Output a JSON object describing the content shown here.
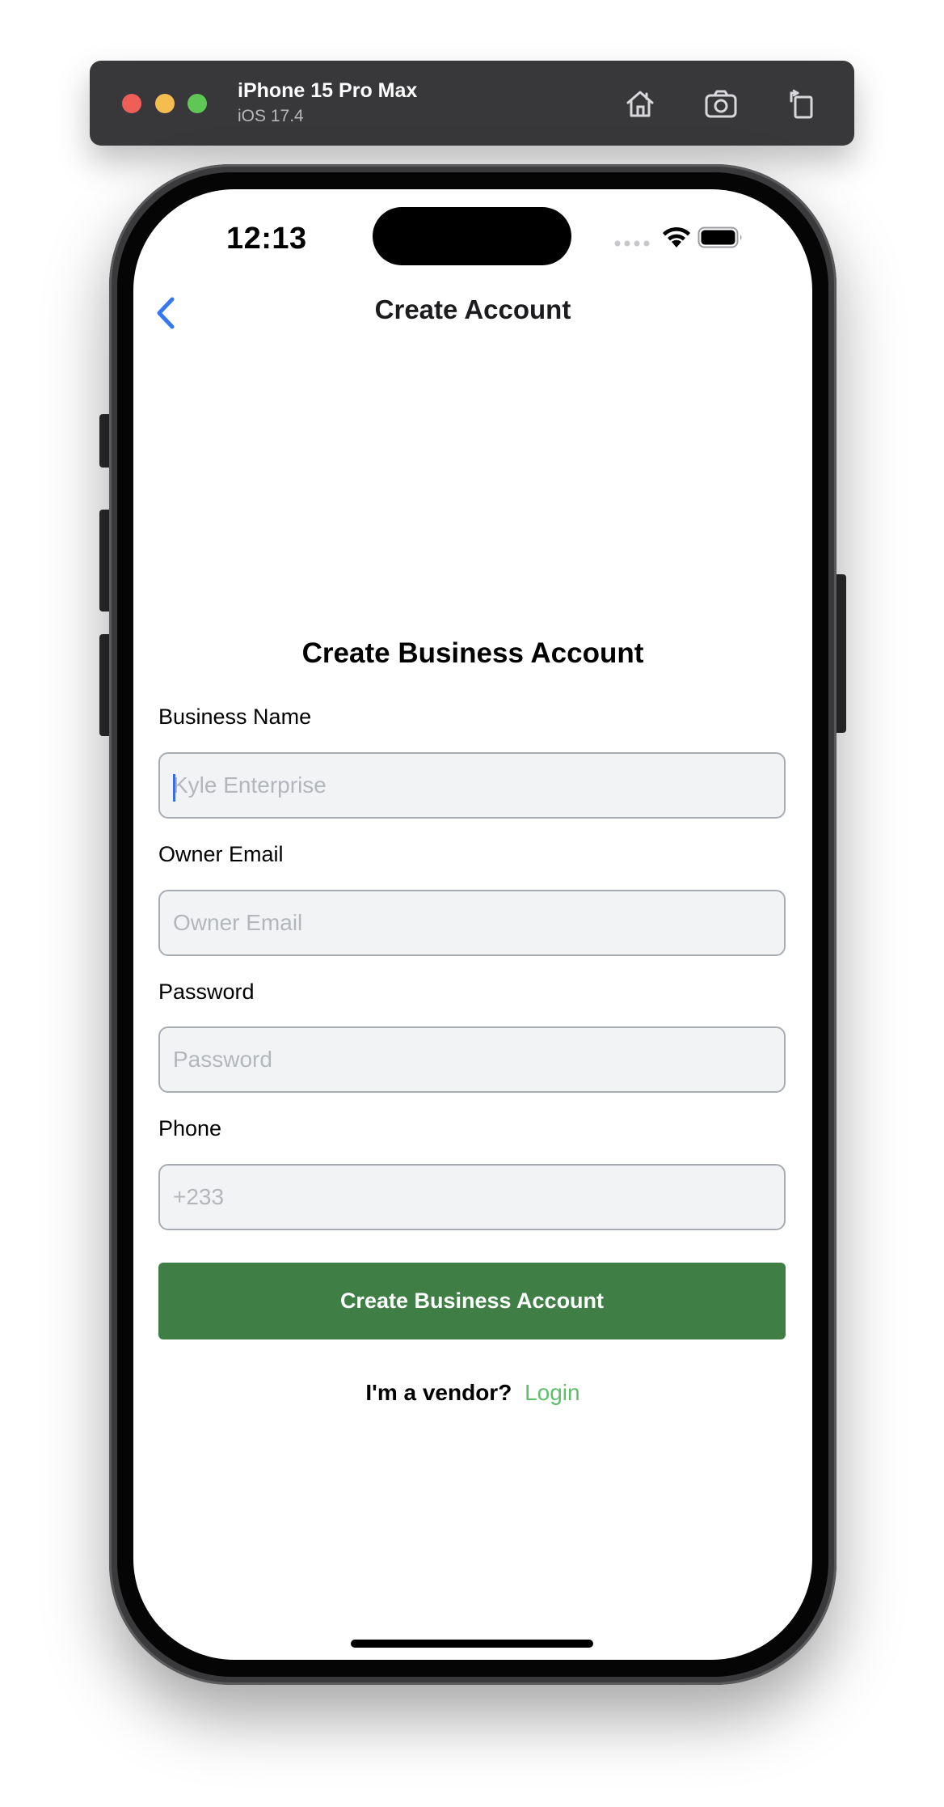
{
  "simulator": {
    "device_name": "iPhone 15 Pro Max",
    "os_version": "iOS 17.4",
    "icons": [
      "home-icon",
      "screenshot-icon",
      "rotate-icon"
    ]
  },
  "status_bar": {
    "time": "12:13",
    "icons": [
      "cellular-dots-icon",
      "wifi-icon",
      "battery-icon"
    ]
  },
  "nav": {
    "title": "Create Account",
    "back_icon": "chevron-left-icon",
    "accent_color": "#3478f6"
  },
  "form": {
    "heading": "Create Business Account",
    "fields": [
      {
        "label": "Business Name",
        "placeholder": "Kyle Enterprise",
        "value": ""
      },
      {
        "label": "Owner Email",
        "placeholder": "Owner Email",
        "value": ""
      },
      {
        "label": "Password",
        "placeholder": "Password",
        "value": ""
      },
      {
        "label": "Phone",
        "placeholder": "+233",
        "value": ""
      }
    ],
    "submit_label": "Create Business Account",
    "submit_color": "#3f7f46"
  },
  "footer": {
    "prompt": "I'm a vendor?",
    "link": "Login",
    "link_color": "#5cbf6a"
  }
}
